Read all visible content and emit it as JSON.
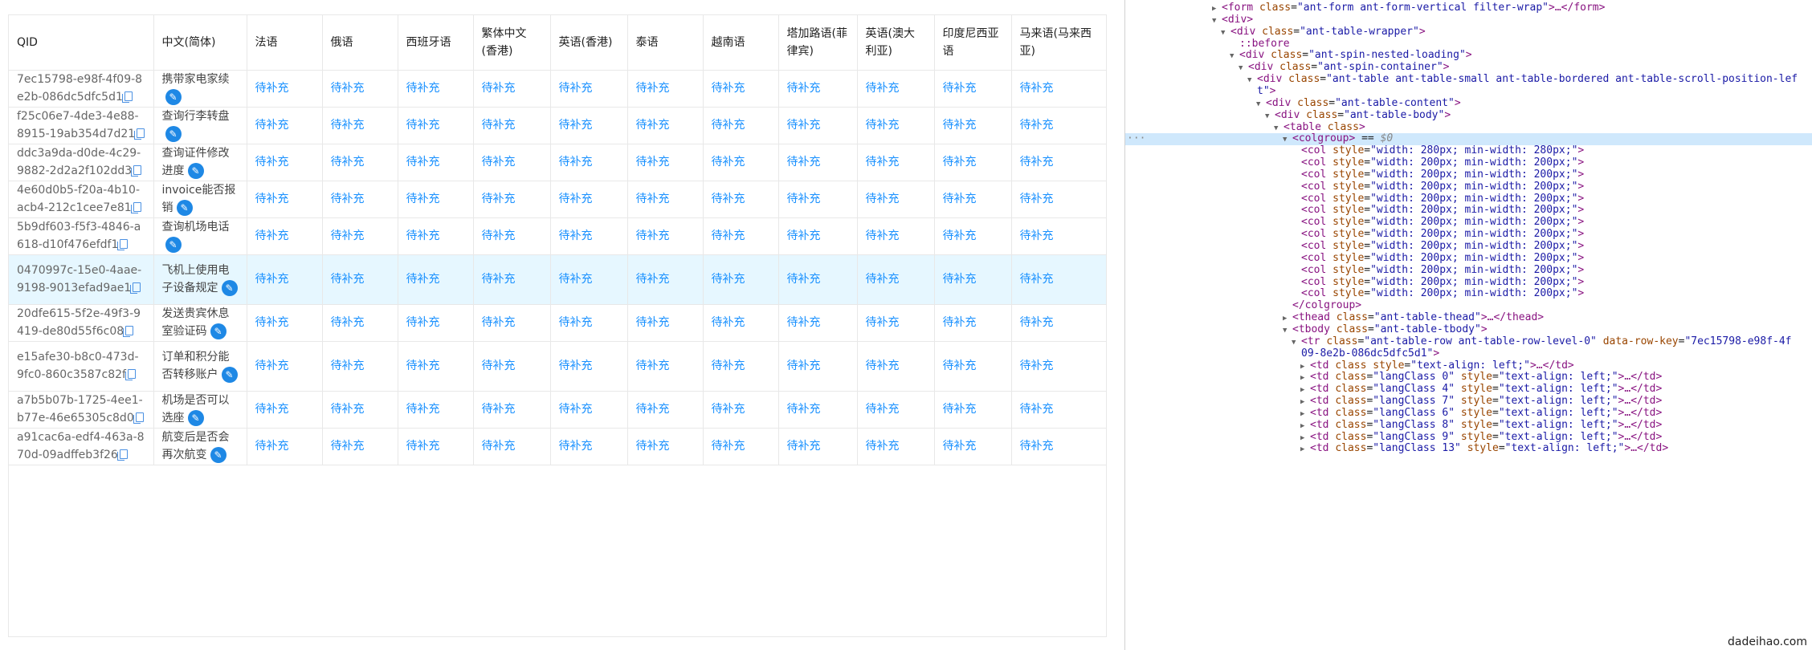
{
  "table": {
    "headers": [
      "QID",
      "中文(简体)",
      "法语",
      "俄语",
      "西班牙语",
      "繁体中文(香港)",
      "英语(香港)",
      "泰语",
      "越南语",
      "塔加路语(菲律宾)",
      "英语(澳大利亚)",
      "印度尼西亚语",
      "马来语(马来西亚)"
    ],
    "pending_label": "待补充",
    "rows": [
      {
        "qid": "7ec15798-e98f-4f09-8e2b-086dc5dfc5d1",
        "zh": "携带家电家续"
      },
      {
        "qid": "f25c06e7-4de3-4e88-8915-19ab354d7d21",
        "zh": "查询行李转盘"
      },
      {
        "qid": "ddc3a9da-d0de-4c29-9882-2d2a2f102dd3",
        "zh": "查询证件修改进度"
      },
      {
        "qid": "4e60d0b5-f20a-4b10-acb4-212c1cee7e81",
        "zh": "invoice能否报销"
      },
      {
        "qid": "5b9df603-f5f3-4846-a618-d10f476efdf1",
        "zh": "查询机场电话"
      },
      {
        "qid": "0470997c-15e0-4aae-9198-9013efad9ae1",
        "zh": "飞机上使用电子设备规定"
      },
      {
        "qid": "20dfe615-5f2e-49f3-9419-de80d55f6c08",
        "zh": "发送贵宾休息室验证码"
      },
      {
        "qid": "e15afe30-b8c0-473d-9fc0-860c3587c82f",
        "zh": "订单和积分能否转移账户"
      },
      {
        "qid": "a7b5b07b-1725-4ee1-b77e-46e65305c8d0",
        "zh": "机场是否可以选座"
      },
      {
        "qid": "a91cac6a-edf4-463a-870d-09adffeb3f26",
        "zh": "航变后是否会再次航变"
      }
    ]
  },
  "devtools": {
    "lines": [
      {
        "indent": 0,
        "tri": "▶",
        "parts": [
          [
            "tag",
            "<form "
          ],
          [
            "attr-name",
            "class"
          ],
          [
            "eq",
            "="
          ],
          [
            "attr-val",
            "\"ant-form ant-form-vertical filter-wrap\""
          ],
          [
            "tag",
            ">…</form>"
          ]
        ]
      },
      {
        "indent": 0,
        "tri": "▼",
        "parts": [
          [
            "tag",
            "<div>"
          ]
        ]
      },
      {
        "indent": 1,
        "tri": "▼",
        "parts": [
          [
            "tag",
            "<div "
          ],
          [
            "attr-name",
            "class"
          ],
          [
            "eq",
            "="
          ],
          [
            "attr-val",
            "\"ant-table-wrapper\""
          ],
          [
            "tag",
            ">"
          ]
        ]
      },
      {
        "indent": 2,
        "tri": "",
        "parts": [
          [
            "pseudo",
            "::before"
          ]
        ]
      },
      {
        "indent": 2,
        "tri": "▼",
        "parts": [
          [
            "tag",
            "<div "
          ],
          [
            "attr-name",
            "class"
          ],
          [
            "eq",
            "="
          ],
          [
            "attr-val",
            "\"ant-spin-nested-loading\""
          ],
          [
            "tag",
            ">"
          ]
        ]
      },
      {
        "indent": 3,
        "tri": "▼",
        "parts": [
          [
            "tag",
            "<div "
          ],
          [
            "attr-name",
            "class"
          ],
          [
            "eq",
            "="
          ],
          [
            "attr-val",
            "\"ant-spin-container\""
          ],
          [
            "tag",
            ">"
          ]
        ]
      },
      {
        "indent": 4,
        "tri": "▼",
        "parts": [
          [
            "tag",
            "<div "
          ],
          [
            "attr-name",
            "class"
          ],
          [
            "eq",
            "="
          ],
          [
            "attr-val",
            "\"ant-table ant-table-small ant-table-bordered ant-table-scroll-position-lef"
          ]
        ]
      },
      {
        "indent": 4,
        "tri": "",
        "parts": [
          [
            "attr-val",
            "t\""
          ],
          [
            "tag",
            ">"
          ]
        ]
      },
      {
        "indent": 5,
        "tri": "▼",
        "parts": [
          [
            "tag",
            "<div "
          ],
          [
            "attr-name",
            "class"
          ],
          [
            "eq",
            "="
          ],
          [
            "attr-val",
            "\"ant-table-content\""
          ],
          [
            "tag",
            ">"
          ]
        ]
      },
      {
        "indent": 6,
        "tri": "▼",
        "parts": [
          [
            "tag",
            "<div "
          ],
          [
            "attr-name",
            "class"
          ],
          [
            "eq",
            "="
          ],
          [
            "attr-val",
            "\"ant-table-body\""
          ],
          [
            "tag",
            ">"
          ]
        ]
      },
      {
        "indent": 7,
        "tri": "▼",
        "parts": [
          [
            "tag",
            "<table "
          ],
          [
            "attr-name",
            "class"
          ],
          [
            "tag",
            ">"
          ]
        ]
      },
      {
        "indent": 8,
        "tri": "▼",
        "selected": true,
        "parts": [
          [
            "tag",
            "<colgroup>"
          ],
          [
            "eq",
            " == "
          ],
          [
            "dollar",
            "$0"
          ]
        ]
      },
      {
        "indent": 9,
        "tri": "",
        "parts": [
          [
            "tag",
            "<col "
          ],
          [
            "attr-name",
            "style"
          ],
          [
            "eq",
            "="
          ],
          [
            "attr-val",
            "\"width: 280px; min-width: 280px;\""
          ],
          [
            "tag",
            ">"
          ]
        ]
      },
      {
        "indent": 9,
        "tri": "",
        "parts": [
          [
            "tag",
            "<col "
          ],
          [
            "attr-name",
            "style"
          ],
          [
            "eq",
            "="
          ],
          [
            "attr-val",
            "\"width: 200px; min-width: 200px;\""
          ],
          [
            "tag",
            ">"
          ]
        ]
      },
      {
        "indent": 9,
        "tri": "",
        "parts": [
          [
            "tag",
            "<col "
          ],
          [
            "attr-name",
            "style"
          ],
          [
            "eq",
            "="
          ],
          [
            "attr-val",
            "\"width: 200px; min-width: 200px;\""
          ],
          [
            "tag",
            ">"
          ]
        ]
      },
      {
        "indent": 9,
        "tri": "",
        "parts": [
          [
            "tag",
            "<col "
          ],
          [
            "attr-name",
            "style"
          ],
          [
            "eq",
            "="
          ],
          [
            "attr-val",
            "\"width: 200px; min-width: 200px;\""
          ],
          [
            "tag",
            ">"
          ]
        ]
      },
      {
        "indent": 9,
        "tri": "",
        "parts": [
          [
            "tag",
            "<col "
          ],
          [
            "attr-name",
            "style"
          ],
          [
            "eq",
            "="
          ],
          [
            "attr-val",
            "\"width: 200px; min-width: 200px;\""
          ],
          [
            "tag",
            ">"
          ]
        ]
      },
      {
        "indent": 9,
        "tri": "",
        "parts": [
          [
            "tag",
            "<col "
          ],
          [
            "attr-name",
            "style"
          ],
          [
            "eq",
            "="
          ],
          [
            "attr-val",
            "\"width: 200px; min-width: 200px;\""
          ],
          [
            "tag",
            ">"
          ]
        ]
      },
      {
        "indent": 9,
        "tri": "",
        "parts": [
          [
            "tag",
            "<col "
          ],
          [
            "attr-name",
            "style"
          ],
          [
            "eq",
            "="
          ],
          [
            "attr-val",
            "\"width: 200px; min-width: 200px;\""
          ],
          [
            "tag",
            ">"
          ]
        ]
      },
      {
        "indent": 9,
        "tri": "",
        "parts": [
          [
            "tag",
            "<col "
          ],
          [
            "attr-name",
            "style"
          ],
          [
            "eq",
            "="
          ],
          [
            "attr-val",
            "\"width: 200px; min-width: 200px;\""
          ],
          [
            "tag",
            ">"
          ]
        ]
      },
      {
        "indent": 9,
        "tri": "",
        "parts": [
          [
            "tag",
            "<col "
          ],
          [
            "attr-name",
            "style"
          ],
          [
            "eq",
            "="
          ],
          [
            "attr-val",
            "\"width: 200px; min-width: 200px;\""
          ],
          [
            "tag",
            ">"
          ]
        ]
      },
      {
        "indent": 9,
        "tri": "",
        "parts": [
          [
            "tag",
            "<col "
          ],
          [
            "attr-name",
            "style"
          ],
          [
            "eq",
            "="
          ],
          [
            "attr-val",
            "\"width: 200px; min-width: 200px;\""
          ],
          [
            "tag",
            ">"
          ]
        ]
      },
      {
        "indent": 9,
        "tri": "",
        "parts": [
          [
            "tag",
            "<col "
          ],
          [
            "attr-name",
            "style"
          ],
          [
            "eq",
            "="
          ],
          [
            "attr-val",
            "\"width: 200px; min-width: 200px;\""
          ],
          [
            "tag",
            ">"
          ]
        ]
      },
      {
        "indent": 9,
        "tri": "",
        "parts": [
          [
            "tag",
            "<col "
          ],
          [
            "attr-name",
            "style"
          ],
          [
            "eq",
            "="
          ],
          [
            "attr-val",
            "\"width: 200px; min-width: 200px;\""
          ],
          [
            "tag",
            ">"
          ]
        ]
      },
      {
        "indent": 9,
        "tri": "",
        "parts": [
          [
            "tag",
            "<col "
          ],
          [
            "attr-name",
            "style"
          ],
          [
            "eq",
            "="
          ],
          [
            "attr-val",
            "\"width: 200px; min-width: 200px;\""
          ],
          [
            "tag",
            ">"
          ]
        ]
      },
      {
        "indent": 8,
        "tri": "",
        "parts": [
          [
            "tag",
            "</colgroup>"
          ]
        ]
      },
      {
        "indent": 8,
        "tri": "▶",
        "parts": [
          [
            "tag",
            "<thead "
          ],
          [
            "attr-name",
            "class"
          ],
          [
            "eq",
            "="
          ],
          [
            "attr-val",
            "\"ant-table-thead\""
          ],
          [
            "tag",
            ">…</thead>"
          ]
        ]
      },
      {
        "indent": 8,
        "tri": "▼",
        "parts": [
          [
            "tag",
            "<tbody "
          ],
          [
            "attr-name",
            "class"
          ],
          [
            "eq",
            "="
          ],
          [
            "attr-val",
            "\"ant-table-tbody\""
          ],
          [
            "tag",
            ">"
          ]
        ]
      },
      {
        "indent": 9,
        "tri": "▼",
        "parts": [
          [
            "tag",
            "<tr "
          ],
          [
            "attr-name",
            "class"
          ],
          [
            "eq",
            "="
          ],
          [
            "attr-val",
            "\"ant-table-row ant-table-row-level-0\" "
          ],
          [
            "attr-name",
            "data-row-key"
          ],
          [
            "eq",
            "="
          ],
          [
            "attr-val",
            "\"7ec15798-e98f-4f"
          ]
        ]
      },
      {
        "indent": 9,
        "tri": "",
        "parts": [
          [
            "attr-val",
            "09-8e2b-086dc5dfc5d1\""
          ],
          [
            "tag",
            ">"
          ]
        ]
      },
      {
        "indent": 10,
        "tri": "▶",
        "parts": [
          [
            "tag",
            "<td "
          ],
          [
            "attr-name",
            "class "
          ],
          [
            "attr-name",
            "style"
          ],
          [
            "eq",
            "="
          ],
          [
            "attr-val",
            "\"text-align: left;\""
          ],
          [
            "tag",
            ">…</td>"
          ]
        ]
      },
      {
        "indent": 10,
        "tri": "▶",
        "parts": [
          [
            "tag",
            "<td "
          ],
          [
            "attr-name",
            "class"
          ],
          [
            "eq",
            "="
          ],
          [
            "attr-val",
            "\"langClass 0\" "
          ],
          [
            "attr-name",
            "style"
          ],
          [
            "eq",
            "="
          ],
          [
            "attr-val",
            "\"text-align: left;\""
          ],
          [
            "tag",
            ">…</td>"
          ]
        ]
      },
      {
        "indent": 10,
        "tri": "▶",
        "parts": [
          [
            "tag",
            "<td "
          ],
          [
            "attr-name",
            "class"
          ],
          [
            "eq",
            "="
          ],
          [
            "attr-val",
            "\"langClass 4\" "
          ],
          [
            "attr-name",
            "style"
          ],
          [
            "eq",
            "="
          ],
          [
            "attr-val",
            "\"text-align: left;\""
          ],
          [
            "tag",
            ">…</td>"
          ]
        ]
      },
      {
        "indent": 10,
        "tri": "▶",
        "parts": [
          [
            "tag",
            "<td "
          ],
          [
            "attr-name",
            "class"
          ],
          [
            "eq",
            "="
          ],
          [
            "attr-val",
            "\"langClass 7\" "
          ],
          [
            "attr-name",
            "style"
          ],
          [
            "eq",
            "="
          ],
          [
            "attr-val",
            "\"text-align: left;\""
          ],
          [
            "tag",
            ">…</td>"
          ]
        ]
      },
      {
        "indent": 10,
        "tri": "▶",
        "parts": [
          [
            "tag",
            "<td "
          ],
          [
            "attr-name",
            "class"
          ],
          [
            "eq",
            "="
          ],
          [
            "attr-val",
            "\"langClass 6\" "
          ],
          [
            "attr-name",
            "style"
          ],
          [
            "eq",
            "="
          ],
          [
            "attr-val",
            "\"text-align: left;\""
          ],
          [
            "tag",
            ">…</td>"
          ]
        ]
      },
      {
        "indent": 10,
        "tri": "▶",
        "parts": [
          [
            "tag",
            "<td "
          ],
          [
            "attr-name",
            "class"
          ],
          [
            "eq",
            "="
          ],
          [
            "attr-val",
            "\"langClass 8\" "
          ],
          [
            "attr-name",
            "style"
          ],
          [
            "eq",
            "="
          ],
          [
            "attr-val",
            "\"text-align: left;\""
          ],
          [
            "tag",
            ">…</td>"
          ]
        ]
      },
      {
        "indent": 10,
        "tri": "▶",
        "parts": [
          [
            "tag",
            "<td "
          ],
          [
            "attr-name",
            "class"
          ],
          [
            "eq",
            "="
          ],
          [
            "attr-val",
            "\"langClass 9\" "
          ],
          [
            "attr-name",
            "style"
          ],
          [
            "eq",
            "="
          ],
          [
            "attr-val",
            "\"text-align: left;\""
          ],
          [
            "tag",
            ">…</td>"
          ]
        ]
      },
      {
        "indent": 10,
        "tri": "▶",
        "parts": [
          [
            "tag",
            "<td "
          ],
          [
            "attr-name",
            "class"
          ],
          [
            "eq",
            "="
          ],
          [
            "attr-val",
            "\"langClass 13\" "
          ],
          [
            "attr-name",
            "style"
          ],
          [
            "eq",
            "="
          ],
          [
            "attr-val",
            "\"text-align: left;\""
          ],
          [
            "tag",
            ">…</td>"
          ]
        ]
      }
    ],
    "selected_marker": "···",
    "watermark": "dadeihao.com"
  }
}
